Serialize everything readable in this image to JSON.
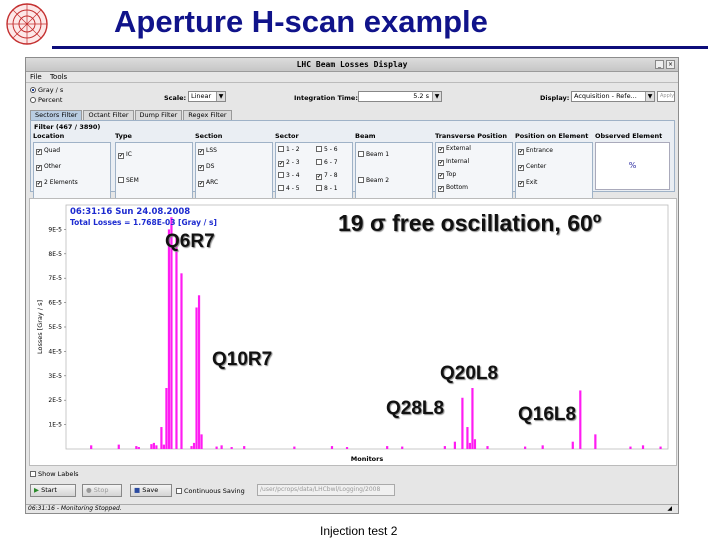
{
  "slide": {
    "title": "Aperture H-scan example",
    "caption": "Injection test 2"
  },
  "window": {
    "title": "LHC Beam Losses Display",
    "menu": [
      "File",
      "Tools"
    ],
    "units": [
      {
        "label": "Gray / s",
        "selected": true
      },
      {
        "label": "Percent",
        "selected": false
      }
    ],
    "scale_label": "Scale:",
    "scale_value": "Linear",
    "integration_label": "Integration Time:",
    "integration_value": "5.2 s",
    "display_label": "Display:",
    "display_value": "Acquisition - Refe...",
    "display_button": "Apply"
  },
  "tabs": [
    {
      "label": "Sectors Filter",
      "active": true
    },
    {
      "label": "Octant Filter",
      "active": false
    },
    {
      "label": "Dump Filter",
      "active": false
    },
    {
      "label": "Regex Filter",
      "active": false
    }
  ],
  "filter": {
    "title": "Filter (467 / 3890)",
    "location": {
      "header": "Location",
      "items": [
        {
          "label": "Quad",
          "checked": true
        },
        {
          "label": "Other",
          "checked": true
        },
        {
          "label": "2 Elements",
          "checked": true
        }
      ]
    },
    "type": {
      "header": "Type",
      "items": [
        {
          "label": "IC",
          "checked": true
        },
        {
          "label": "SEM",
          "checked": false
        }
      ]
    },
    "section": {
      "header": "Section",
      "items": [
        {
          "label": "LSS",
          "checked": true
        },
        {
          "label": "DS",
          "checked": true
        },
        {
          "label": "ARC",
          "checked": true
        }
      ]
    },
    "sector": {
      "header": "Sector",
      "items": [
        {
          "label": "1 - 2",
          "checked": false
        },
        {
          "label": "5 - 6",
          "checked": false
        },
        {
          "label": "2 - 3",
          "checked": true
        },
        {
          "label": "6 - 7",
          "checked": false
        },
        {
          "label": "3 - 4",
          "checked": false
        },
        {
          "label": "7 - 8",
          "checked": true
        },
        {
          "label": "4 - 5",
          "checked": false
        },
        {
          "label": "8 - 1",
          "checked": false
        }
      ]
    },
    "beam": {
      "header": "Beam",
      "items": [
        {
          "label": "Beam 1",
          "checked": false
        },
        {
          "label": "Beam 2",
          "checked": false
        }
      ]
    },
    "transverse": {
      "header": "Transverse Position",
      "items": [
        {
          "label": "External",
          "checked": true
        },
        {
          "label": "Internal",
          "checked": true
        },
        {
          "label": "Top",
          "checked": true
        },
        {
          "label": "Bottom",
          "checked": true
        }
      ]
    },
    "position": {
      "header": "Position on Element",
      "items": [
        {
          "label": "Entrance",
          "checked": true
        },
        {
          "label": "Center",
          "checked": true
        },
        {
          "label": "Exit",
          "checked": true
        }
      ]
    },
    "observed": {
      "header": "Observed Element",
      "value": "%"
    }
  },
  "chart_data": {
    "type": "bar",
    "timestamp": "06:31:16  Sun 24.08.2008",
    "total_losses": "Total Losses = 1.768E-03 [Gray / s]",
    "xlabel": "Monitors",
    "ylabel": "Losses [Gray / s]",
    "yticks": [
      "9E-5",
      "8E-5",
      "7E-5",
      "6E-5",
      "5E-5",
      "4E-5",
      "3E-5",
      "2E-5",
      "1E-5"
    ],
    "ylim": [
      0,
      0.0001
    ],
    "xlim": [
      0,
      240
    ],
    "bar_color": "#ff1cf2",
    "series_x": [
      10,
      21,
      28,
      29,
      34,
      35,
      36,
      38,
      39,
      40,
      41,
      42,
      44,
      46,
      50,
      51,
      52,
      53,
      54,
      60,
      62,
      66,
      71,
      91,
      106,
      112,
      128,
      134,
      151,
      155,
      158,
      160,
      161,
      162,
      163,
      168,
      183,
      190,
      202,
      205,
      211,
      225,
      230,
      237
    ],
    "series_y": [
      1.5e-06,
      1.8e-06,
      1.2e-06,
      8e-07,
      2e-06,
      2.5e-06,
      1.5e-06,
      9e-06,
      1.8e-06,
      2.5e-05,
      9e-05,
      9.5e-05,
      8.7e-05,
      7.2e-05,
      1.2e-06,
      2.5e-06,
      5.8e-05,
      6.3e-05,
      6e-06,
      1e-06,
      1.5e-06,
      8e-07,
      1.2e-06,
      1e-06,
      1.2e-06,
      8e-07,
      1.2e-06,
      1e-06,
      1.2e-06,
      3e-06,
      2.1e-05,
      9e-06,
      2.5e-06,
      2.5e-05,
      4e-06,
      1.2e-06,
      1e-06,
      1.5e-06,
      3e-06,
      2.4e-05,
      6e-06,
      1e-06,
      1.5e-06,
      1e-06
    ]
  },
  "annotations": {
    "q6r7": "Q6R7",
    "q10r7": "Q10R7",
    "q20l8": "Q20L8",
    "q28l8": "Q28L8",
    "q16l8": "Q16L8",
    "oscillation": "19 σ free oscillation, 60º"
  },
  "controls": {
    "show_labels": "Show Labels",
    "start": "Start",
    "stop": "Stop",
    "save": "Save",
    "continuous_saving": "Continuous Saving",
    "path": "/user/pcrops/data/LHCbwl/Logging/2008",
    "status": "06:31:16 - Monitoring Stopped."
  }
}
